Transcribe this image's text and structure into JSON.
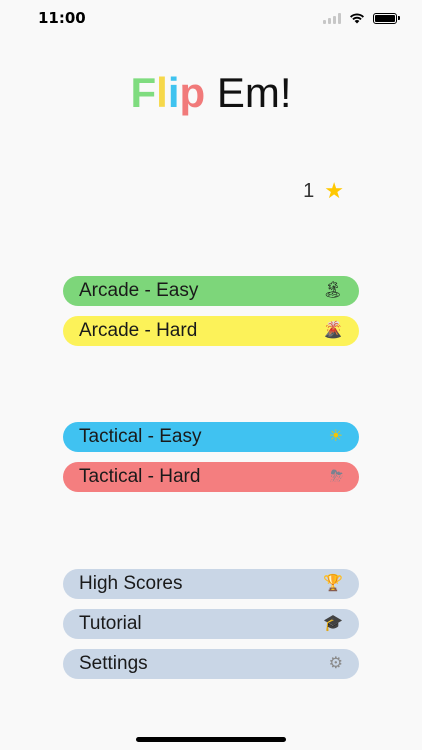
{
  "status_bar": {
    "time": "11:00"
  },
  "title": {
    "letters": [
      "F",
      "l",
      "i",
      "p"
    ],
    "rest": " Em!"
  },
  "stars": {
    "count": "1",
    "icon": "star-icon"
  },
  "menu": {
    "arcade_easy": {
      "label": "Arcade - Easy",
      "icon": "🏝"
    },
    "arcade_hard": {
      "label": "Arcade - Hard",
      "icon": "🌋"
    },
    "tactical_easy": {
      "label": "Tactical - Easy",
      "icon": "☀"
    },
    "tactical_hard": {
      "label": "Tactical - Hard",
      "icon": "⛈"
    },
    "high_scores": {
      "label": "High Scores",
      "icon": "🏆"
    },
    "tutorial": {
      "label": "Tutorial",
      "icon": "🎓"
    },
    "settings": {
      "label": "Settings",
      "icon": "⚙"
    }
  },
  "colors": {
    "arcade_easy": "#7dd67a",
    "arcade_hard": "#fcf259",
    "tactical_easy": "#40c2f1",
    "tactical_hard": "#f47e7f",
    "utility": "#c9d6e6",
    "star": "#ffc800"
  }
}
